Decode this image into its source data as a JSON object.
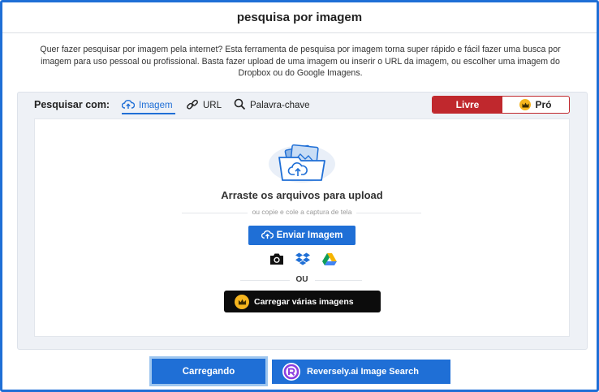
{
  "header": {
    "title": "pesquisa por imagem"
  },
  "intro": {
    "text": "Quer fazer pesquisar por imagem pela internet? Esta ferramenta de pesquisa por imagem torna super rápido e fácil fazer uma busca por imagem para uso pessoal ou profissional. Basta fazer upload de uma imagem ou inserir o URL da imagem, ou escolher uma imagem do Dropbox ou do Google Imagens."
  },
  "search": {
    "label": "Pesquisar com:",
    "tabs": [
      {
        "label": "Imagem",
        "icon": "cloud-upload-icon",
        "active": true
      },
      {
        "label": "URL",
        "icon": "link-icon",
        "active": false
      },
      {
        "label": "Palavra-chave",
        "icon": "search-icon",
        "active": false
      }
    ]
  },
  "plans": {
    "free_label": "Livre",
    "pro_label": "Pró",
    "selected": "Livre"
  },
  "dropzone": {
    "title": "Arraste os arquivos para upload",
    "paste_hint": "ou copie e cole a captura de tela",
    "upload_label": "Enviar Imagem",
    "sources": [
      "camera-icon",
      "dropbox-icon",
      "google-drive-icon"
    ],
    "or_label": "OU",
    "multi_label": "Carregar várias imagens"
  },
  "footer": {
    "loading_label": "Carregando",
    "reversely_label": "Reversely.ai Image Search"
  },
  "colors": {
    "accent": "#1f6fd6",
    "free": "#c0282d",
    "crown": "#f6b51e"
  }
}
